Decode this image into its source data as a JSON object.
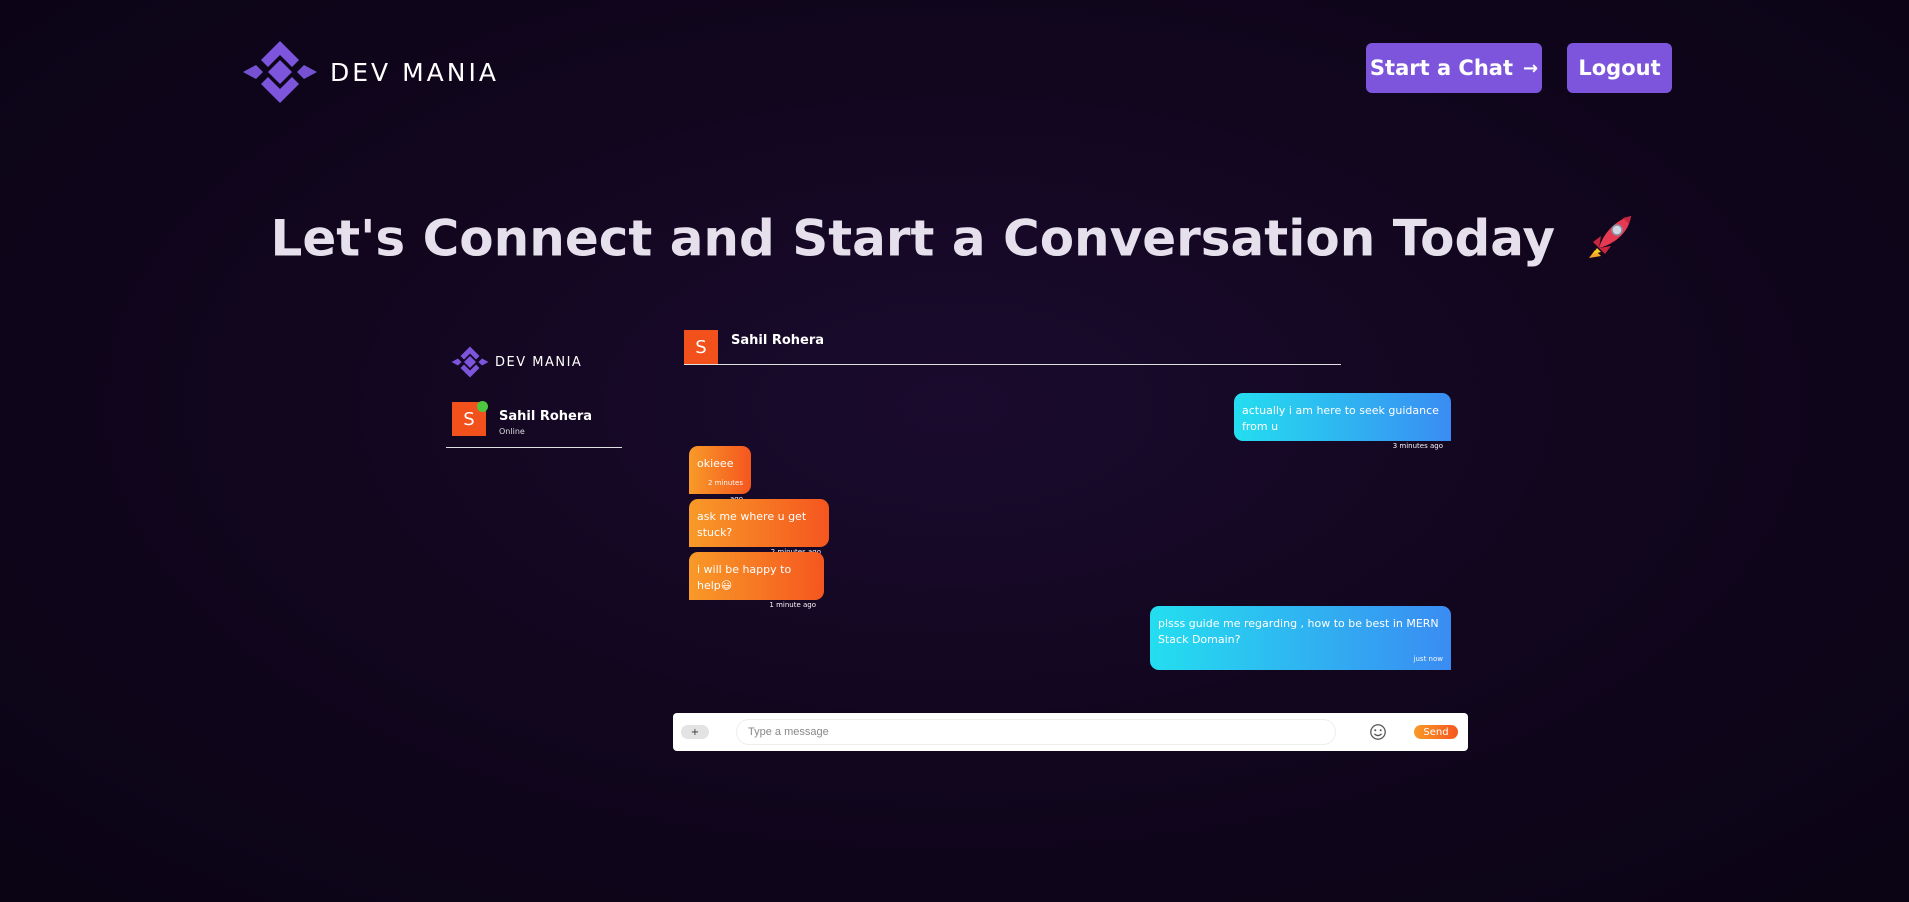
{
  "header": {
    "brand": "DEV MANIA",
    "start_chat_label": "Start a Chat",
    "start_chat_icon": "arrow-right-icon",
    "logout_label": "Logout"
  },
  "hero": {
    "title": "Let's Connect and Start a Conversation Today",
    "icon": "rocket-icon"
  },
  "sidebar": {
    "brand": "DEV MANIA",
    "contacts": [
      {
        "initial": "S",
        "name": "Sahil Rohera",
        "status": "Online"
      }
    ]
  },
  "chat": {
    "contact_initial": "S",
    "contact_name": "Sahil Rohera",
    "messages": [
      {
        "direction": "outgoing",
        "text": "actually i am here to seek guidance from u",
        "time": "3 minutes ago"
      },
      {
        "direction": "incoming",
        "text": "okieee",
        "time": "2 minutes ago"
      },
      {
        "direction": "incoming",
        "text": "ask me where u get stuck?",
        "time": "2 minutes ago"
      },
      {
        "direction": "incoming",
        "text": "i will be happy to help😃",
        "time": "1 minute ago"
      },
      {
        "direction": "outgoing",
        "text": "plsss guide me regarding , how to be best in MERN Stack Domain?",
        "time": "just now"
      }
    ]
  },
  "composer": {
    "attach_label": "+",
    "placeholder": "Type a message",
    "value": "",
    "emoji_icon": "smiley-icon",
    "send_label": "Send"
  },
  "colors": {
    "background": "#12061f",
    "accent": "#7c55dc",
    "avatar": "#f2511b",
    "incoming_gradient": [
      "#f89a28",
      "#f5561f"
    ],
    "outgoing_gradient": [
      "#24def0",
      "#3a8cf2"
    ]
  }
}
